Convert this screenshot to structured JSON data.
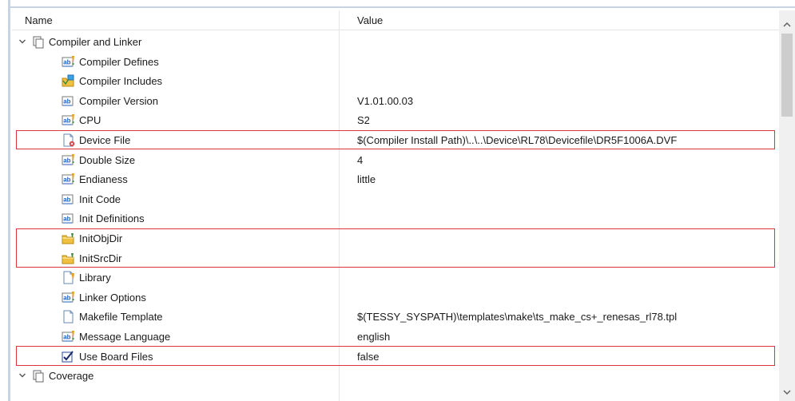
{
  "table": {
    "col_name": "Name",
    "col_value": "Value"
  },
  "groups": [
    {
      "label": "Compiler and Linker",
      "expanded": true
    },
    {
      "label": "Coverage",
      "expanded": true
    }
  ],
  "rows": [
    {
      "name": "Compiler Defines",
      "value": "",
      "icon": "text-edit-icon"
    },
    {
      "name": "Compiler Includes",
      "value": "",
      "icon": "folder-list-icon"
    },
    {
      "name": "Compiler Version",
      "value": "V1.01.00.03",
      "icon": "text-icon"
    },
    {
      "name": "CPU",
      "value": "S2",
      "icon": "text-edit-icon"
    },
    {
      "name": "Device File",
      "value": "$(Compiler Install Path)\\..\\..\\Device\\RL78\\Devicefile\\DR5F1006A.DVF",
      "icon": "file-error-icon"
    },
    {
      "name": "Double Size",
      "value": "4",
      "icon": "text-edit-icon"
    },
    {
      "name": "Endianess",
      "value": "little",
      "icon": "text-edit-icon"
    },
    {
      "name": "Init Code",
      "value": "",
      "icon": "text-icon"
    },
    {
      "name": "Init Definitions",
      "value": "",
      "icon": "text-icon"
    },
    {
      "name": "InitObjDir",
      "value": "",
      "icon": "folder-icon"
    },
    {
      "name": "InitSrcDir",
      "value": "",
      "icon": "folder-icon"
    },
    {
      "name": "Library",
      "value": "",
      "icon": "file-edit-icon"
    },
    {
      "name": "Linker Options",
      "value": "",
      "icon": "text-edit-icon"
    },
    {
      "name": "Makefile Template",
      "value": "$(TESSY_SYSPATH)\\templates\\make\\ts_make_cs+_renesas_rl78.tpl",
      "icon": "file-icon"
    },
    {
      "name": "Message Language",
      "value": "english",
      "icon": "text-edit-icon"
    },
    {
      "name": "Use Board Files",
      "value": "false",
      "icon": "checkbox-icon"
    }
  ],
  "colors": {
    "highlight": "#d9363e",
    "folder": "#f0c040",
    "text_icon_blue": "#1f5fbf"
  },
  "scrollbar": {
    "up": "▲",
    "down": "▼"
  }
}
